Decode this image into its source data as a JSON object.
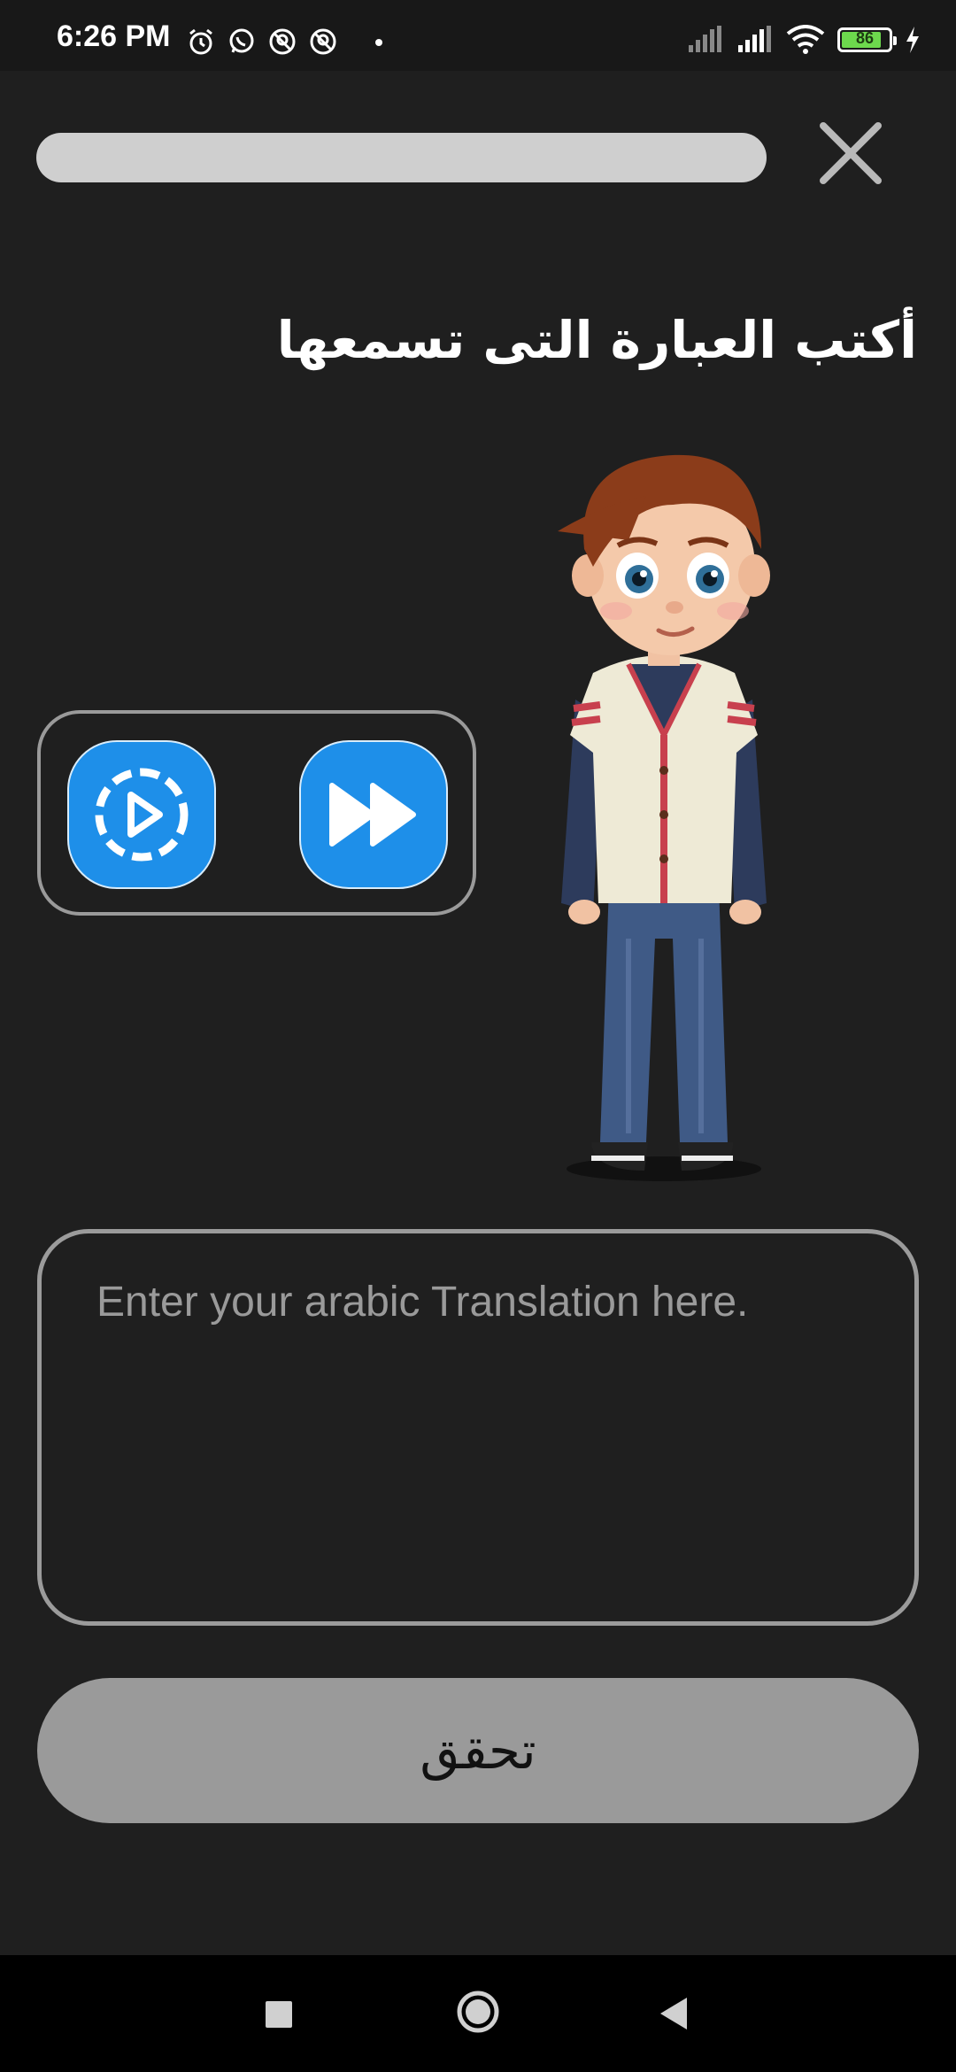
{
  "status_bar": {
    "time": "6:26 PM",
    "battery_level": 86,
    "battery_text": "86",
    "icons_left": [
      "alarm-icon",
      "whatsapp-icon",
      "location-off-icon",
      "location-off-icon"
    ],
    "icons_right": [
      "signal-icon",
      "signal-icon",
      "wifi-icon",
      "battery-icon",
      "charging-icon"
    ]
  },
  "lesson": {
    "progress_fraction": 0,
    "prompt": "أكتب العبارة التى تسمعها"
  },
  "audio": {
    "slow_icon": "slow-play-icon",
    "fast_icon": "fast-forward-icon"
  },
  "answer": {
    "placeholder": "Enter your arabic Translation here.",
    "value": ""
  },
  "check_button": {
    "label": "تحقق"
  },
  "colors": {
    "background": "#1f1f1f",
    "accent_blue": "#1e8fe9",
    "button_gray": "#9a9a9a",
    "border_gray": "#9b9b9b",
    "progress_track": "#cfcfcf"
  },
  "nav_bar": {
    "icons": [
      "recent-apps-icon",
      "home-icon",
      "back-icon"
    ]
  }
}
